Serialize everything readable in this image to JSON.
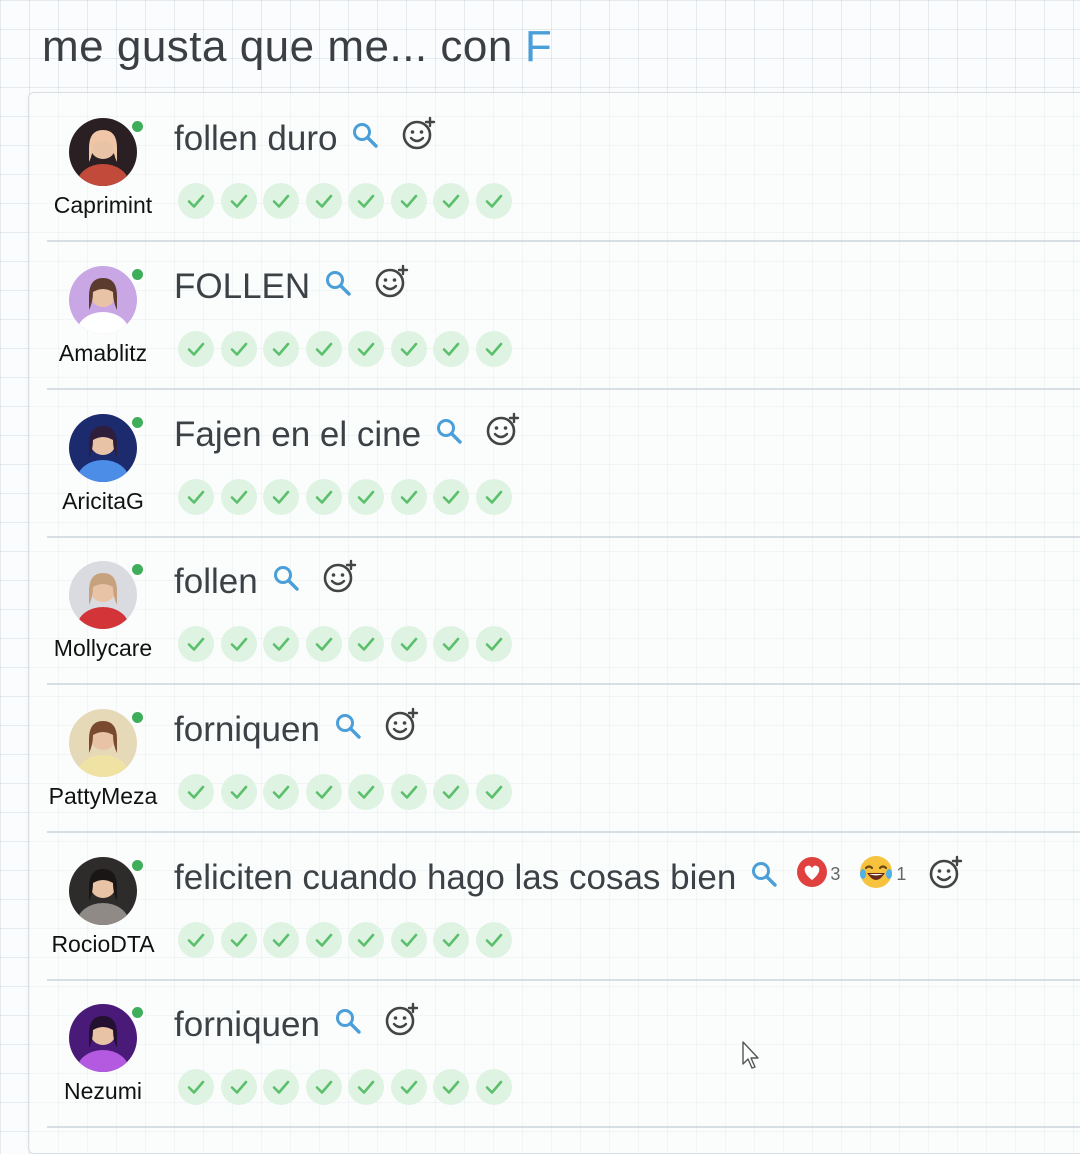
{
  "prompt": {
    "text": "me gusta que me... con",
    "letter": "F"
  },
  "answers": [
    {
      "user": "Caprimint",
      "text": "follen duro",
      "checks": 8,
      "reactions": []
    },
    {
      "user": "Amablitz",
      "text": "FOLLEN",
      "checks": 8,
      "reactions": []
    },
    {
      "user": "AricitaG",
      "text": "Fajen en el cine",
      "checks": 8,
      "reactions": []
    },
    {
      "user": "Mollycare",
      "text": "follen",
      "checks": 8,
      "reactions": []
    },
    {
      "user": "PattyMeza",
      "text": "forniquen",
      "checks": 8,
      "reactions": []
    },
    {
      "user": "RocioDTA",
      "text": "feliciten cuando hago las cosas bien",
      "checks": 8,
      "reactions": [
        {
          "icon": "heart-icon",
          "count": "3"
        },
        {
          "icon": "laughing-emoji-icon",
          "count": "1"
        }
      ]
    },
    {
      "user": "Nezumi",
      "text": "forniquen",
      "checks": 8,
      "reactions": []
    }
  ],
  "colors": {
    "accent": "#4a9fd8",
    "check": "#5cbf6c",
    "check_bg": "#dff3e2",
    "online": "#3fae5a",
    "heart": "#e0413e"
  }
}
